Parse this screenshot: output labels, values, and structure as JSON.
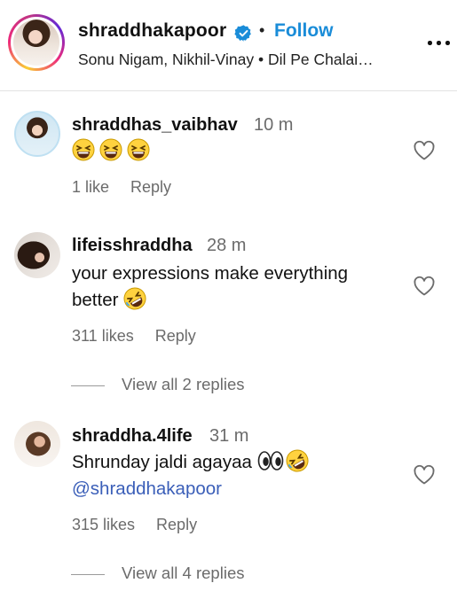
{
  "post_header": {
    "username": "shraddhakapoor",
    "separator": "•",
    "follow_label": "Follow",
    "music_text": "Sonu Nigam, Nikhil-Vinay • Dil Pe Chalai…",
    "avatar_icon": "profile-photo",
    "verified_icon": "verified-badge-icon",
    "more_icon": "more-options-icon",
    "accent_color": "#1a8cd8"
  },
  "comments": [
    {
      "username": "shraddhas_vaibhav",
      "time": "10 m",
      "text": "",
      "emoji": [
        "grinning-squinting-face",
        "grinning-squinting-face",
        "grinning-squinting-face"
      ],
      "likes": "1 like",
      "reply_label": "Reply"
    },
    {
      "username": "lifeisshraddha",
      "time": "28 m",
      "text_line1": "your expressions make everything",
      "text_line2": "better",
      "emoji": [
        "rolling-on-floor-laughing"
      ],
      "likes": "311 likes",
      "reply_label": "Reply",
      "view_replies": "View all 2 replies"
    },
    {
      "username": "shraddha.4life",
      "time": "31 m",
      "text_line1": "Shrunday jaldi agayaa",
      "text_line2": "@shraddhakapoor",
      "emoji": [
        "eyes",
        "rolling-on-floor-laughing"
      ],
      "likes": "315 likes",
      "reply_label": "Reply",
      "view_replies": "View all 4 replies"
    }
  ]
}
